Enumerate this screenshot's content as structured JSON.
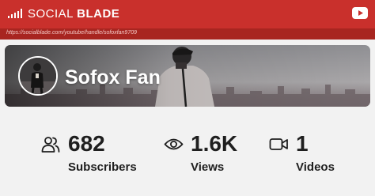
{
  "header": {
    "brand_light": "SOCIAL ",
    "brand_bold": "BLADE",
    "brand_color": "#c9302c",
    "url": "https://socialblade.com/youtube/handle/sofoxfan9709",
    "icons": [
      "signal-bars-icon",
      "youtube-icon"
    ]
  },
  "channel": {
    "name": "Sofox Fan"
  },
  "stats": [
    {
      "icon": "users-icon",
      "value": "682",
      "label": "Subscribers"
    },
    {
      "icon": "eye-icon",
      "value": "1.6K",
      "label": "Views"
    },
    {
      "icon": "video-camera-icon",
      "value": "1",
      "label": "Videos"
    }
  ]
}
